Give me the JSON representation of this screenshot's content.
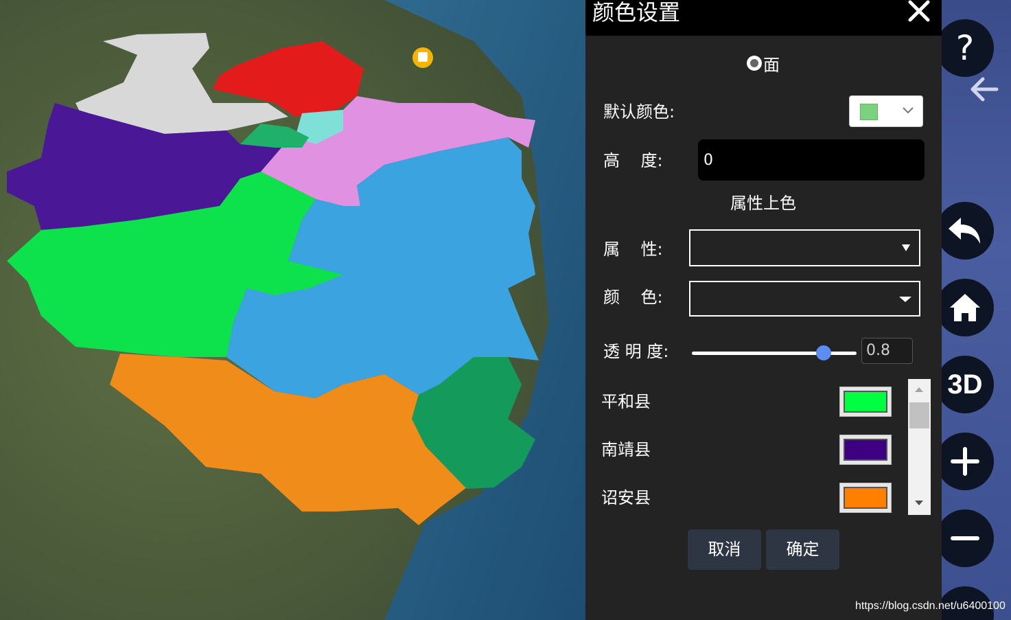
{
  "dialog": {
    "title": "颜色设置",
    "radio_face": "面",
    "default_color_label": "默认颜色:",
    "default_color": "#7cd27c",
    "height_label": "高    度:",
    "height_value": "0",
    "attr_section_title": "属性上色",
    "attribute_label": "属    性:",
    "attribute_value": "",
    "color_label": "颜    色:",
    "color_value": "",
    "opacity_label": "透 明 度:",
    "opacity_value": "0.8",
    "opacity_fraction": 0.8,
    "cancel_label": "取消",
    "confirm_label": "确定",
    "counties": [
      {
        "name": "平和县",
        "color": "#00ff40"
      },
      {
        "name": "南靖县",
        "color": "#3d0080"
      },
      {
        "name": "诏安县",
        "color": "#ff8000"
      }
    ]
  },
  "toolbar": {
    "help": "?",
    "three_d": "3D"
  },
  "watermark": "https://blog.csdn.net/u6400100"
}
